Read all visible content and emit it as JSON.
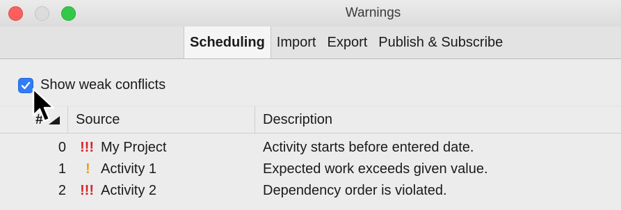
{
  "window": {
    "title": "Warnings"
  },
  "tabs": [
    {
      "label": "Scheduling",
      "active": true
    },
    {
      "label": "Import",
      "active": false
    },
    {
      "label": "Export",
      "active": false
    },
    {
      "label": "Publish & Subscribe",
      "active": false
    }
  ],
  "options": {
    "show_weak_conflicts_label": "Show weak conflicts",
    "show_weak_conflicts_checked": true
  },
  "table": {
    "columns": {
      "number": "#",
      "source": "Source",
      "description": "Description"
    },
    "rows": [
      {
        "number": "0",
        "severity": "!!!",
        "source": "My Project",
        "description": "Activity starts before entered date."
      },
      {
        "number": "1",
        "severity": "!",
        "source": "Activity 1",
        "description": "Expected work exceeds given value."
      },
      {
        "number": "2",
        "severity": "!!!",
        "source": "Activity 2",
        "description": "Dependency order is violated."
      }
    ]
  },
  "colors": {
    "checkbox_blue": "#2f7cf6",
    "severity_high": "#d9232a",
    "severity_low": "#f09a1a"
  }
}
